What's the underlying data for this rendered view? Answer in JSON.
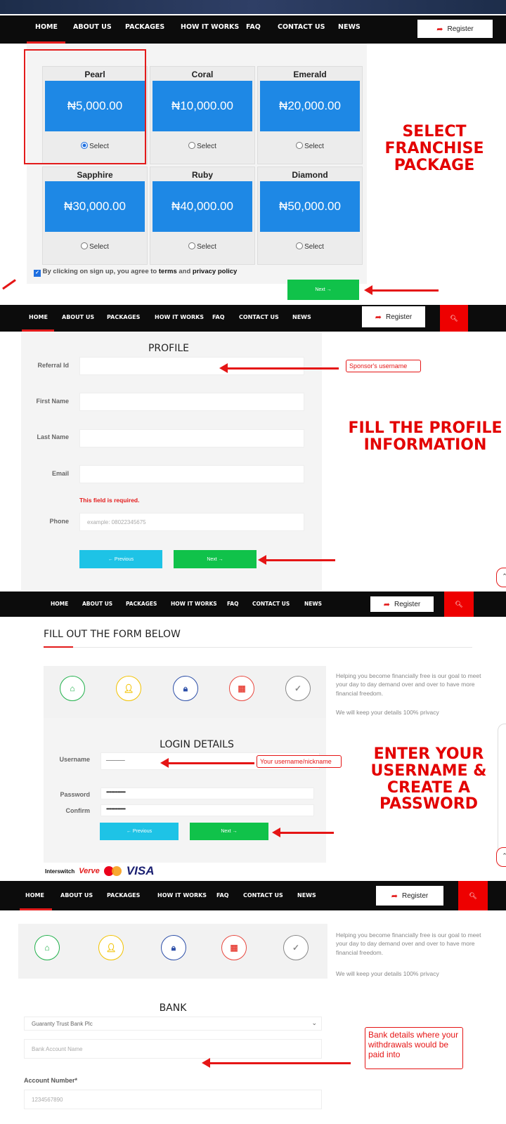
{
  "nav": {
    "items": [
      "HOME",
      "ABOUT US",
      "PACKAGES",
      "HOW IT WORKS",
      "FAQ",
      "CONTACT US",
      "NEWS"
    ],
    "register_label": "Register",
    "register_icon": "share-arrow-icon",
    "search_icon": "search-icon"
  },
  "packages": {
    "cards": [
      {
        "name": "Pearl",
        "price": "₦5,000.00",
        "select_label": "Select",
        "selected": true
      },
      {
        "name": "Coral",
        "price": "₦10,000.00",
        "select_label": "Select",
        "selected": false
      },
      {
        "name": "Emerald",
        "price": "₦20,000.00",
        "select_label": "Select",
        "selected": false
      },
      {
        "name": "Sapphire",
        "price": "₦30,000.00",
        "select_label": "Select",
        "selected": false
      },
      {
        "name": "Ruby",
        "price": "₦40,000.00",
        "select_label": "Select",
        "selected": false
      },
      {
        "name": "Diamond",
        "price": "₦50,000.00",
        "select_label": "Select",
        "selected": false
      }
    ],
    "agree_prefix": "By clicking on sign up, you agree to ",
    "terms": "terms",
    "and": " and ",
    "privacy": "privacy policy",
    "agree_checked": true,
    "next_label": "Next →",
    "annotation": "SELECT FRANCHISE PACKAGE"
  },
  "profile": {
    "title": "PROFILE",
    "referral_label": "Referral Id",
    "first_name_label": "First Name",
    "last_name_label": "Last Name",
    "email_label": "Email",
    "error": "This field is required.",
    "phone_label": "Phone",
    "phone_placeholder": "example: 08022345675",
    "previous_label": "← Previous",
    "next_label": "Next →",
    "callout": "Sponsor's username",
    "annotation": "FILL THE PROFILE INFORMATION"
  },
  "login": {
    "heading": "FILL OUT THE FORM BELOW",
    "side_text": "Helping you become financially free is our goal to meet your day to day demand over and over to have more financial freedom.",
    "privacy_text": "We will keep your details 100% privacy",
    "title": "LOGIN DETAILS",
    "username_label": "Username",
    "username_value": "______",
    "password_label": "Password",
    "password_value": "•••••••••••••••",
    "confirm_label": "Confirm",
    "confirm_value": "•••••••••••••••",
    "previous_label": "← Previous",
    "next_label": "Next →",
    "callout": "Your username/nickname",
    "annotation": "ENTER YOUR USERNAME & CREATE A PASSWORD",
    "payment_brands": [
      "Interswitch",
      "Verve",
      "MasterCard",
      "VISA"
    ]
  },
  "bank": {
    "side_text": "Helping you become financially free is our goal to meet your day to day demand over and over to have more financial freedom.",
    "privacy_text": "We will keep your details 100% privacy",
    "title": "BANK",
    "bank_select": "Guaranty Trust Bank Plc",
    "account_name_placeholder": "Bank Account Name",
    "account_number_label": "Account Number*",
    "account_number_value": "1234567890",
    "callout": "Bank details where your withdrawals would be paid into"
  },
  "steps": [
    {
      "icon": "home-icon",
      "color": "#22b14c"
    },
    {
      "icon": "user-icon",
      "color": "#f2c200"
    },
    {
      "icon": "lock-icon",
      "color": "#2d4fa8"
    },
    {
      "icon": "grid-icon",
      "color": "#e8483f"
    },
    {
      "icon": "check-icon",
      "color": "#888888"
    }
  ]
}
